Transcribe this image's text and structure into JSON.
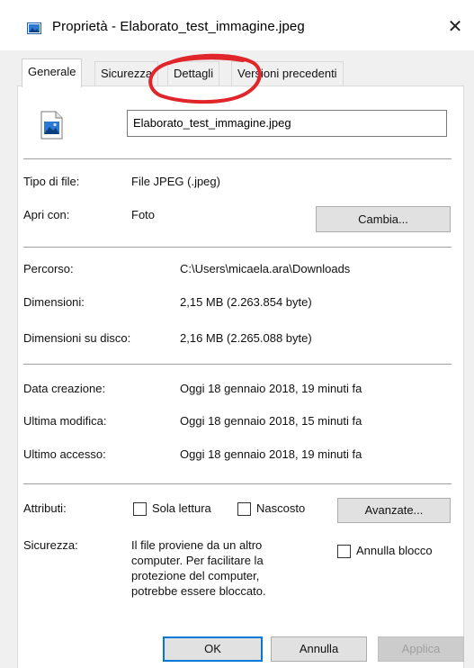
{
  "titlebar": {
    "title": "Proprietà - Elaborato_test_immagine.jpeg",
    "close_glyph": "✕"
  },
  "tabs": [
    {
      "label": "Generale",
      "active": true
    },
    {
      "label": "Sicurezza",
      "active": false
    },
    {
      "label": "Dettagli",
      "active": false
    },
    {
      "label": "Versioni precedenti",
      "active": false
    }
  ],
  "general": {
    "filename": "Elaborato_test_immagine.jpeg",
    "file_type_label": "Tipo di file:",
    "file_type_value": "File JPEG (.jpeg)",
    "open_with_label": "Apri con:",
    "open_with_value": "Foto",
    "change_button": "Cambia...",
    "path_label": "Percorso:",
    "path_value": "C:\\Users\\micaela.ara\\Downloads",
    "size_label": "Dimensioni:",
    "size_value": "2,15 MB (2.263.854 byte)",
    "disk_size_label": "Dimensioni su disco:",
    "disk_size_value": "2,16 MB (2.265.088 byte)",
    "created_label": "Data creazione:",
    "created_value": "Oggi 18 gennaio 2018, 19 minuti fa",
    "modified_label": "Ultima modifica:",
    "modified_value": "Oggi 18 gennaio 2018, 15 minuti fa",
    "accessed_label": "Ultimo accesso:",
    "accessed_value": "Oggi 18 gennaio 2018, 19 minuti fa",
    "attributes_label": "Attributi:",
    "readonly_label": "Sola lettura",
    "hidden_label": "Nascosto",
    "advanced_button": "Avanzate...",
    "security_label": "Sicurezza:",
    "security_text_lines": [
      "Il file proviene da un altro",
      "computer. Per facilitare la",
      "protezione del computer,",
      "potrebbe essere bloccato."
    ],
    "unblock_label": "Annulla blocco"
  },
  "footer": {
    "ok_button": "OK",
    "cancel_button": "Annulla",
    "apply_button": "Applica"
  },
  "colors": {
    "annotation_circle": "#e0262a",
    "focus_border": "#0078d7",
    "image_icon_blue": "#2b79d2"
  },
  "icons": {
    "title": "image-file-icon",
    "file": "image-file-icon"
  }
}
